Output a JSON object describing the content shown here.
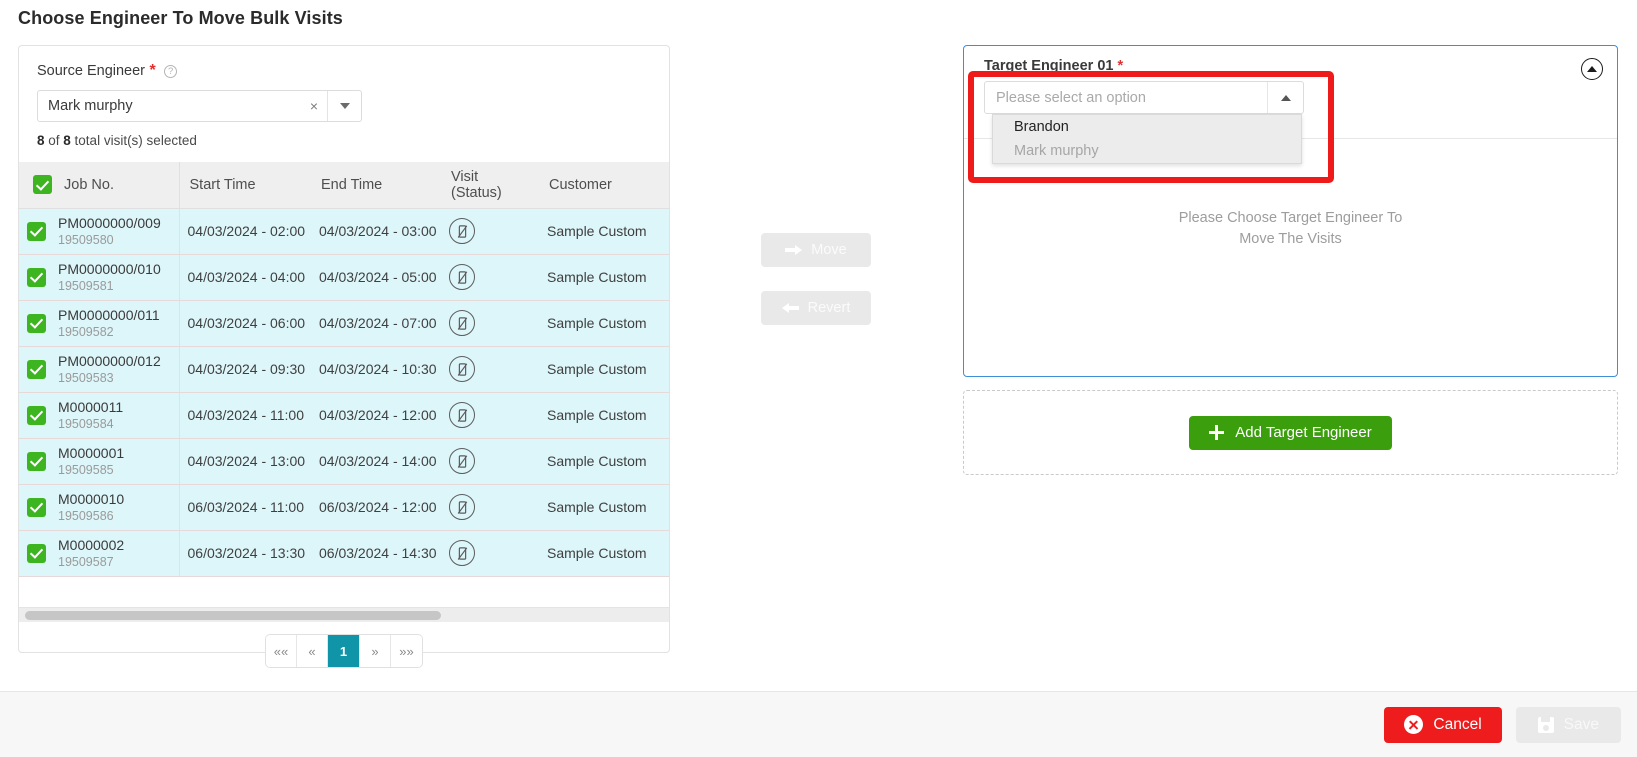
{
  "page": {
    "title": "Choose Engineer To Move Bulk Visits"
  },
  "source": {
    "label": "Source Engineer",
    "required_mark": "*",
    "help_icon": "question-circle-icon",
    "selected_value": "Mark murphy",
    "clear_glyph": "×",
    "count_prefix": "8",
    "count_middle": " of ",
    "count_total": "8",
    "count_suffix": " total visit(s) selected"
  },
  "table": {
    "columns": [
      "Job No.",
      "Start Time",
      "End Time",
      "Visit (Status)",
      "Customer"
    ],
    "header_checkbox_checked": true,
    "rows": [
      {
        "checked": true,
        "job_no": "PM0000000/009",
        "job_id": "19509580",
        "start_time": "04/03/2024 - 02:00",
        "end_time": "04/03/2024 - 03:00",
        "status_icon": "mobile-off-icon",
        "customer": "Sample Custom"
      },
      {
        "checked": true,
        "job_no": "PM0000000/010",
        "job_id": "19509581",
        "start_time": "04/03/2024 - 04:00",
        "end_time": "04/03/2024 - 05:00",
        "status_icon": "mobile-off-icon",
        "customer": "Sample Custom"
      },
      {
        "checked": true,
        "job_no": "PM0000000/011",
        "job_id": "19509582",
        "start_time": "04/03/2024 - 06:00",
        "end_time": "04/03/2024 - 07:00",
        "status_icon": "mobile-off-icon",
        "customer": "Sample Custom"
      },
      {
        "checked": true,
        "job_no": "PM0000000/012",
        "job_id": "19509583",
        "start_time": "04/03/2024 - 09:30",
        "end_time": "04/03/2024 - 10:30",
        "status_icon": "mobile-off-icon",
        "customer": "Sample Custom"
      },
      {
        "checked": true,
        "job_no": "M0000011",
        "job_id": "19509584",
        "start_time": "04/03/2024 - 11:00",
        "end_time": "04/03/2024 - 12:00",
        "status_icon": "mobile-off-icon",
        "customer": "Sample Custom"
      },
      {
        "checked": true,
        "job_no": "M0000001",
        "job_id": "19509585",
        "start_time": "04/03/2024 - 13:00",
        "end_time": "04/03/2024 - 14:00",
        "status_icon": "mobile-off-icon",
        "customer": "Sample Custom"
      },
      {
        "checked": true,
        "job_no": "M0000010",
        "job_id": "19509586",
        "start_time": "06/03/2024 - 11:00",
        "end_time": "06/03/2024 - 12:00",
        "status_icon": "mobile-off-icon",
        "customer": "Sample Custom"
      },
      {
        "checked": true,
        "job_no": "M0000002",
        "job_id": "19509587",
        "start_time": "06/03/2024 - 13:30",
        "end_time": "06/03/2024 - 14:30",
        "status_icon": "mobile-off-icon",
        "customer": "Sample Custom"
      }
    ]
  },
  "pagination": {
    "first": "««",
    "prev": "«",
    "current_page": "1",
    "next": "»",
    "last": "»»"
  },
  "transfer": {
    "move_label": "Move",
    "revert_label": "Revert"
  },
  "target": {
    "label": "Target Engineer 01",
    "required_mark": "*",
    "collapse_icon": "chevron-up-circle-icon",
    "placeholder": "Please select an option",
    "options": [
      {
        "label": "Brandon",
        "disabled": false
      },
      {
        "label": "Mark murphy",
        "disabled": true
      }
    ],
    "empty_line1": "Please Choose Target Engineer To",
    "empty_line2": "Move The Visits",
    "border_color": "#3d8fd8"
  },
  "add_target": {
    "label": "Add Target Engineer",
    "icon": "plus-icon",
    "color": "#3b9e0c"
  },
  "footer": {
    "cancel_label": "Cancel",
    "cancel_icon": "circle-x-icon",
    "cancel_color": "#ee1c1c",
    "save_label": "Save",
    "save_icon": "floppy-disk-icon"
  },
  "annotation": {
    "color": "#ef1b1b"
  }
}
